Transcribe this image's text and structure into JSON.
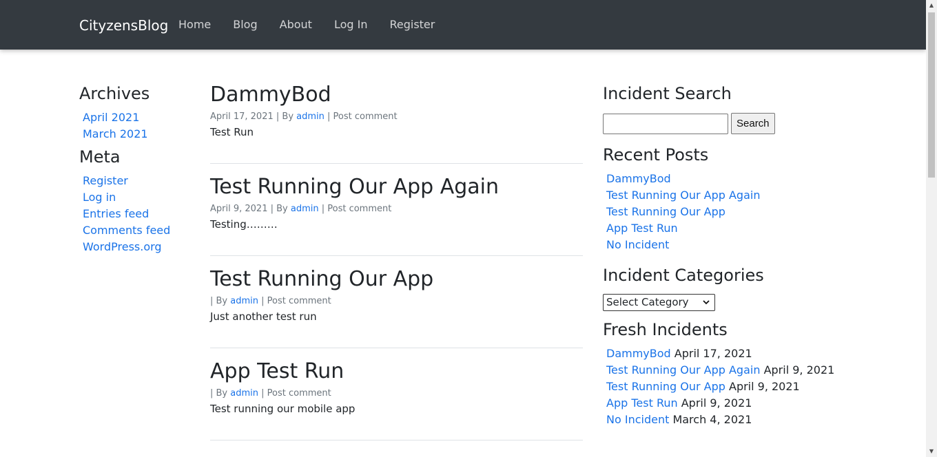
{
  "navbar": {
    "brand": "CityzensBlog",
    "links": [
      "Home",
      "Blog",
      "About",
      "Log In",
      "Register"
    ]
  },
  "archives": {
    "title": "Archives",
    "items": [
      "April 2021",
      "March 2021"
    ]
  },
  "meta": {
    "title": "Meta",
    "items": [
      "Register",
      "Log in",
      "Entries feed",
      "Comments feed",
      "WordPress.org"
    ]
  },
  "posts": [
    {
      "title": "DammyBod",
      "date": "April 17, 2021",
      "by": " | By ",
      "author": "admin",
      "comment": " | Post comment",
      "excerpt": "Test Run"
    },
    {
      "title": "Test Running Our App Again",
      "date": "April 9, 2021",
      "by": " | By ",
      "author": "admin",
      "comment": " | Post comment",
      "excerpt": "Testing………"
    },
    {
      "title": "Test Running Our App",
      "date": "",
      "by": "| By ",
      "author": "admin",
      "comment": " | Post comment",
      "excerpt": "Just another test run"
    },
    {
      "title": "App Test Run",
      "date": "",
      "by": "| By ",
      "author": "admin",
      "comment": " | Post comment",
      "excerpt": "Test running our mobile app"
    }
  ],
  "incident_search": {
    "title": "Incident Search",
    "input_value": "",
    "button": "Search"
  },
  "recent_posts": {
    "title": "Recent Posts",
    "items": [
      "DammyBod",
      "Test Running Our App Again",
      "Test Running Our App",
      "App Test Run",
      "No Incident"
    ]
  },
  "incident_categories": {
    "title": "Incident Categories",
    "selected": "Select Category"
  },
  "fresh_incidents": {
    "title": "Fresh Incidents",
    "items": [
      {
        "link": "DammyBod",
        "date": " April 17, 2021"
      },
      {
        "link": "Test Running Our App Again",
        "date": " April 9, 2021"
      },
      {
        "link": "Test Running Our App",
        "date": " April 9, 2021"
      },
      {
        "link": "App Test Run",
        "date": " April 9, 2021"
      },
      {
        "link": "No Incident",
        "date": " March 4, 2021"
      }
    ]
  },
  "colors": {
    "navbar_bg": "#343a40",
    "link": "#1a73e8",
    "text": "#212529",
    "meta_text": "#6c757d"
  }
}
